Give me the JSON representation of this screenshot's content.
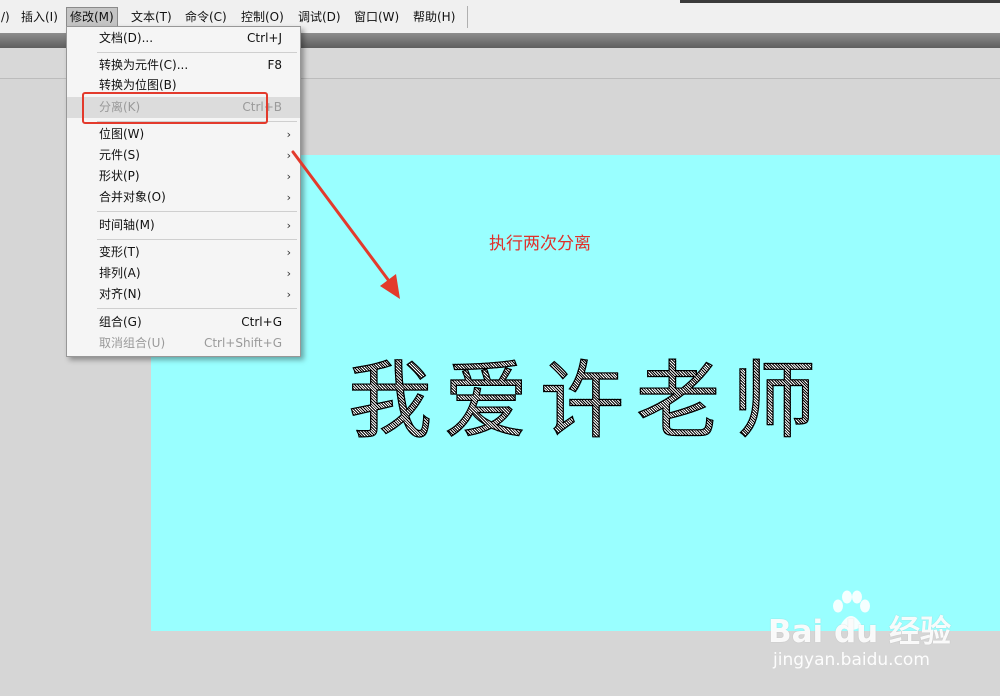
{
  "menubar": {
    "items": [
      {
        "label": "/)"
      },
      {
        "label": "插入(I)"
      },
      {
        "label": "修改(M)"
      },
      {
        "label": "文本(T)"
      },
      {
        "label": "命令(C)"
      },
      {
        "label": "控制(O)"
      },
      {
        "label": "调试(D)"
      },
      {
        "label": "窗口(W)"
      },
      {
        "label": "帮助(H)"
      }
    ],
    "active_index": 2
  },
  "dropdown": {
    "items": [
      {
        "label": "文档(D)...",
        "shortcut": "Ctrl+J"
      },
      {
        "label": "转换为元件(C)...",
        "shortcut": "F8"
      },
      {
        "label": "转换为位图(B)",
        "shortcut": ""
      },
      {
        "label": "分离(K)",
        "shortcut": "Ctrl+B",
        "disabled": true
      },
      {
        "label": "位图(W)",
        "submenu": true
      },
      {
        "label": "元件(S)",
        "submenu": true
      },
      {
        "label": "形状(P)",
        "submenu": true
      },
      {
        "label": "合并对象(O)",
        "submenu": true
      },
      {
        "label": "时间轴(M)",
        "submenu": true
      },
      {
        "label": "变形(T)",
        "submenu": true
      },
      {
        "label": "排列(A)",
        "submenu": true
      },
      {
        "label": "对齐(N)",
        "submenu": true
      },
      {
        "label": "组合(G)",
        "shortcut": "Ctrl+G"
      },
      {
        "label": "取消组合(U)",
        "shortcut": "Ctrl+Shift+G",
        "disabled": true
      }
    ],
    "submenu_glyph": "›"
  },
  "stage": {
    "text": "我爱许老师",
    "background_color": "#99ffff"
  },
  "annotation": {
    "note": "执行两次分离",
    "color": "#e33a2c"
  },
  "watermark": {
    "logo_text": "Bai du 经验",
    "url": "jingyan.baidu.com"
  }
}
